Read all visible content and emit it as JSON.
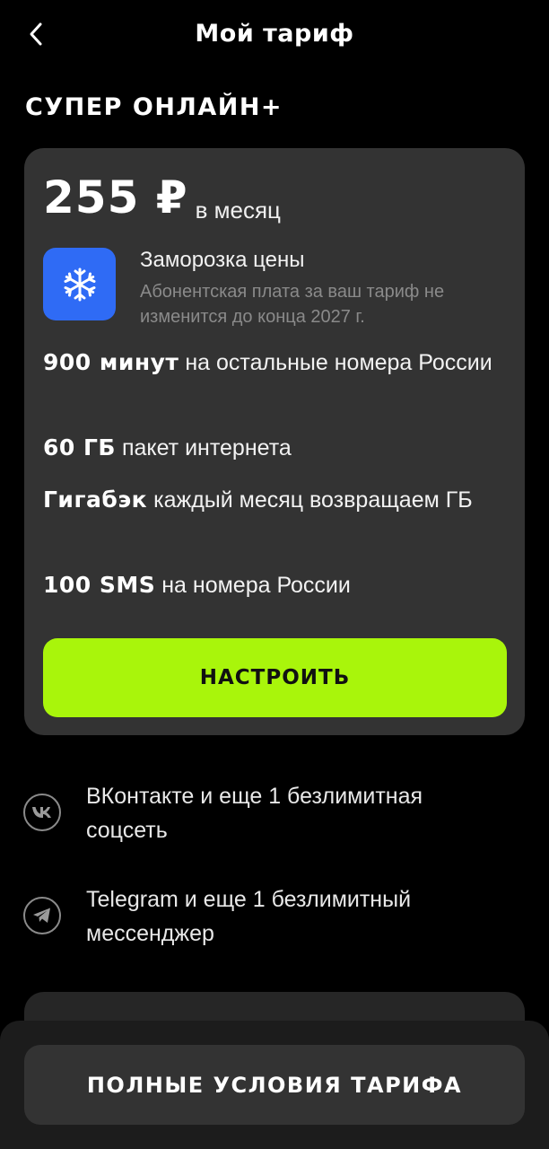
{
  "header": {
    "title": "Мой тариф"
  },
  "plan": {
    "name": "СУПЕР ОНЛАЙН+",
    "price": "255 ₽",
    "price_period": "в месяц"
  },
  "freeze": {
    "icon": "snowflake-icon",
    "title": "Заморозка цены",
    "description": "Абонентская плата за ваш тариф не изменится до конца 2027 г."
  },
  "features": [
    {
      "bold": "900 минут",
      "text": "на остальные номера России"
    },
    {
      "bold": "60 ГБ",
      "text": "пакет интернета"
    },
    {
      "bold": "Гигабэк",
      "text": "каждый месяц возвращаем ГБ"
    },
    {
      "bold": "100 SMS",
      "text": "на номера России"
    }
  ],
  "setup_button": "НАСТРОИТЬ",
  "socials": [
    {
      "icon": "vk-icon",
      "text": "ВКонтакте и еще 1 безлимитная соцсеть"
    },
    {
      "icon": "telegram-icon",
      "text": "Telegram и еще 1 безлимитный мессенджер"
    }
  ],
  "full_terms_button": "ПОЛНЫЕ УСЛОВИЯ ТАРИФА",
  "colors": {
    "background": "#000000",
    "card": "#333333",
    "accent": "#a9f50b",
    "freeze_icon_bg": "#2f6bf5",
    "muted_text": "#8a8a8a"
  }
}
